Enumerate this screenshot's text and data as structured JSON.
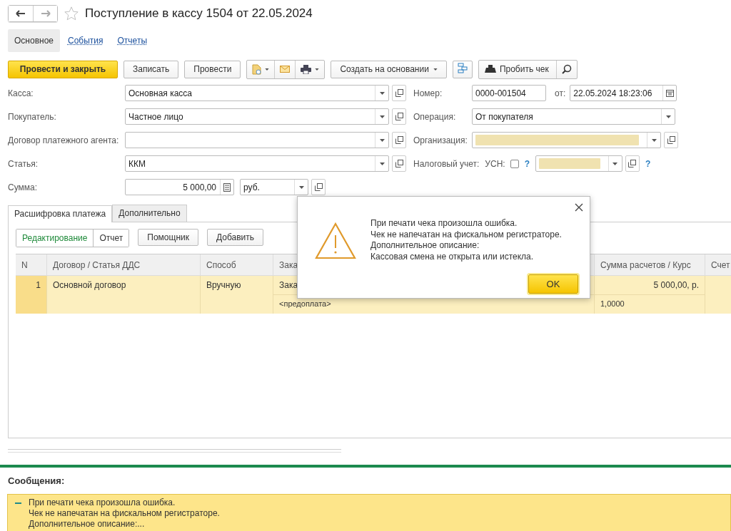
{
  "title": "Поступление в кассу 1504 от 22.05.2024",
  "favorite": false,
  "nav_tabs": [
    {
      "label": "Основное",
      "selected": true
    },
    {
      "label": "События",
      "selected": false
    },
    {
      "label": "Отчеты",
      "selected": false
    }
  ],
  "toolbar": {
    "primary": "Провести и закрыть",
    "write": "Записать",
    "post": "Провести",
    "create_based": "Создать на основании",
    "receipt": "Пробить чек"
  },
  "left_fields": [
    {
      "label": "Касса:",
      "value": "Основная касса",
      "kind": "select"
    },
    {
      "label": "Покупатель:",
      "value": "Частное лицо",
      "kind": "select"
    },
    {
      "label": "Договор платежного агента:",
      "kind": "select"
    },
    {
      "label": "Статья:",
      "value": "ККМ",
      "kind": "select"
    },
    {
      "label": "Сумма:",
      "value": "5 000,00",
      "kind": "amount",
      "currency": "руб."
    }
  ],
  "number": {
    "label": "Номер:",
    "value": "0000-001504",
    "date_label": "от:",
    "date": "22.05.2024 18:23:06"
  },
  "operation": {
    "label": "Операция:",
    "value": "От покупателя"
  },
  "organization": {
    "label": "Организация:",
    "value_hidden": true
  },
  "tax": {
    "label": "Налоговый учет:",
    "usn_label": "УСН:",
    "usn_checked": false,
    "help": "?",
    "value_hidden": true,
    "help2": "?"
  },
  "inner_tabs": [
    {
      "label": "Расшифровка платежа",
      "selected": true
    },
    {
      "label": "Дополнительно",
      "selected": false
    }
  ],
  "table_toolbar": {
    "modes": [
      {
        "label": "Редактирование",
        "selected": true
      },
      {
        "label": "Отчет",
        "selected": false
      }
    ],
    "buttons": [
      "Помощник",
      "Добавить"
    ]
  },
  "table": {
    "columns": [
      "N",
      "Договор / Статья ДДС",
      "Способ",
      "Зака",
      "Сумма расчетов / Курс",
      "Счет"
    ],
    "rows": [
      {
        "n": "1",
        "contract": "Основной договор",
        "method": "Вручную",
        "order": "Зака",
        "order_sub": "<предоплата>",
        "sum": "5 000,00, р.",
        "rate": "1,0000",
        "selected": true
      }
    ]
  },
  "dialog": {
    "lines": [
      "При печати чека произошла ошибка.",
      "Чек не напечатан на фискальном регистраторе.",
      "Дополнительное описание:",
      "Кассовая смена не открыта или истекла."
    ],
    "ok": "OK"
  },
  "messages": {
    "title": "Сообщения:",
    "items": [
      {
        "lines": [
          "При печати чека произошла ошибка.",
          "Чек не напечатан на фискальном регистраторе.",
          "Дополнительное описание:..."
        ]
      }
    ]
  }
}
